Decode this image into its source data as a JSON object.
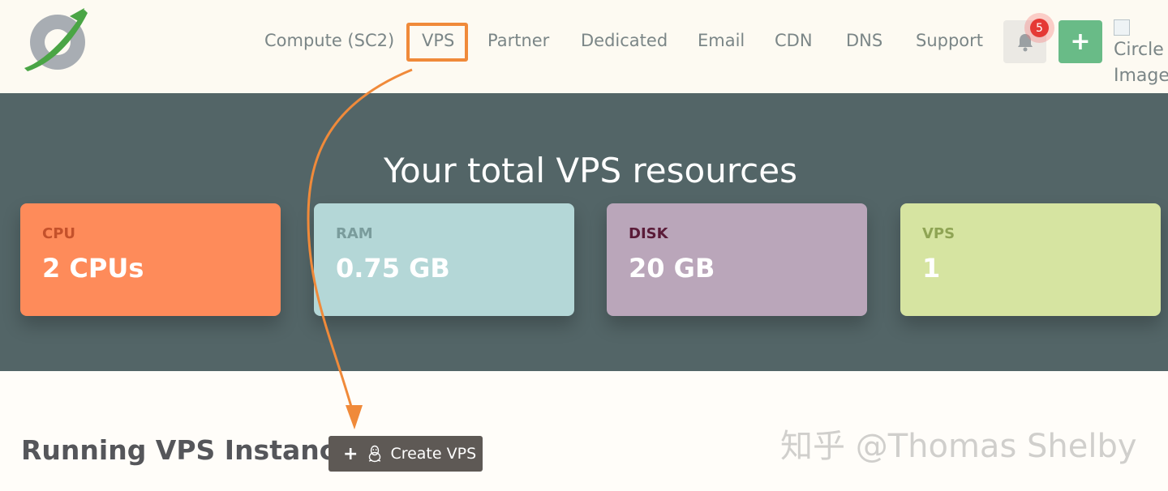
{
  "nav": {
    "items": [
      "Compute (SC2)",
      "VPS",
      "Partner",
      "Dedicated",
      "Email",
      "CDN",
      "DNS",
      "Support"
    ],
    "active": "VPS",
    "notification_count": "5",
    "add_label": "+",
    "profile_image_alt": "Circle Image"
  },
  "hero": {
    "title": "Your total VPS resources",
    "cards": [
      {
        "label": "CPU",
        "value": "2 CPUs",
        "bg": "#fe8b5a",
        "label_color": "#c4512b"
      },
      {
        "label": "RAM",
        "value": "0.75 GB",
        "bg": "#b4d7d7",
        "label_color": "#7a9c9c"
      },
      {
        "label": "DISK",
        "value": "20 GB",
        "bg": "#baa6ba",
        "label_color": "#5a1b38"
      },
      {
        "label": "VPS",
        "value": "1",
        "bg": "#d6e4a1",
        "label_color": "#8fa454"
      }
    ]
  },
  "instances": {
    "title": "Running VPS Instances",
    "create_button": "Create VPS"
  },
  "watermark": "知乎 @Thomas Shelby",
  "colors": {
    "annotation_orange": "#f08a3a",
    "hero_bg": "#536567",
    "nav_bg": "#fdfaf2",
    "add_button": "#69bb87",
    "badge": "#e53935"
  }
}
